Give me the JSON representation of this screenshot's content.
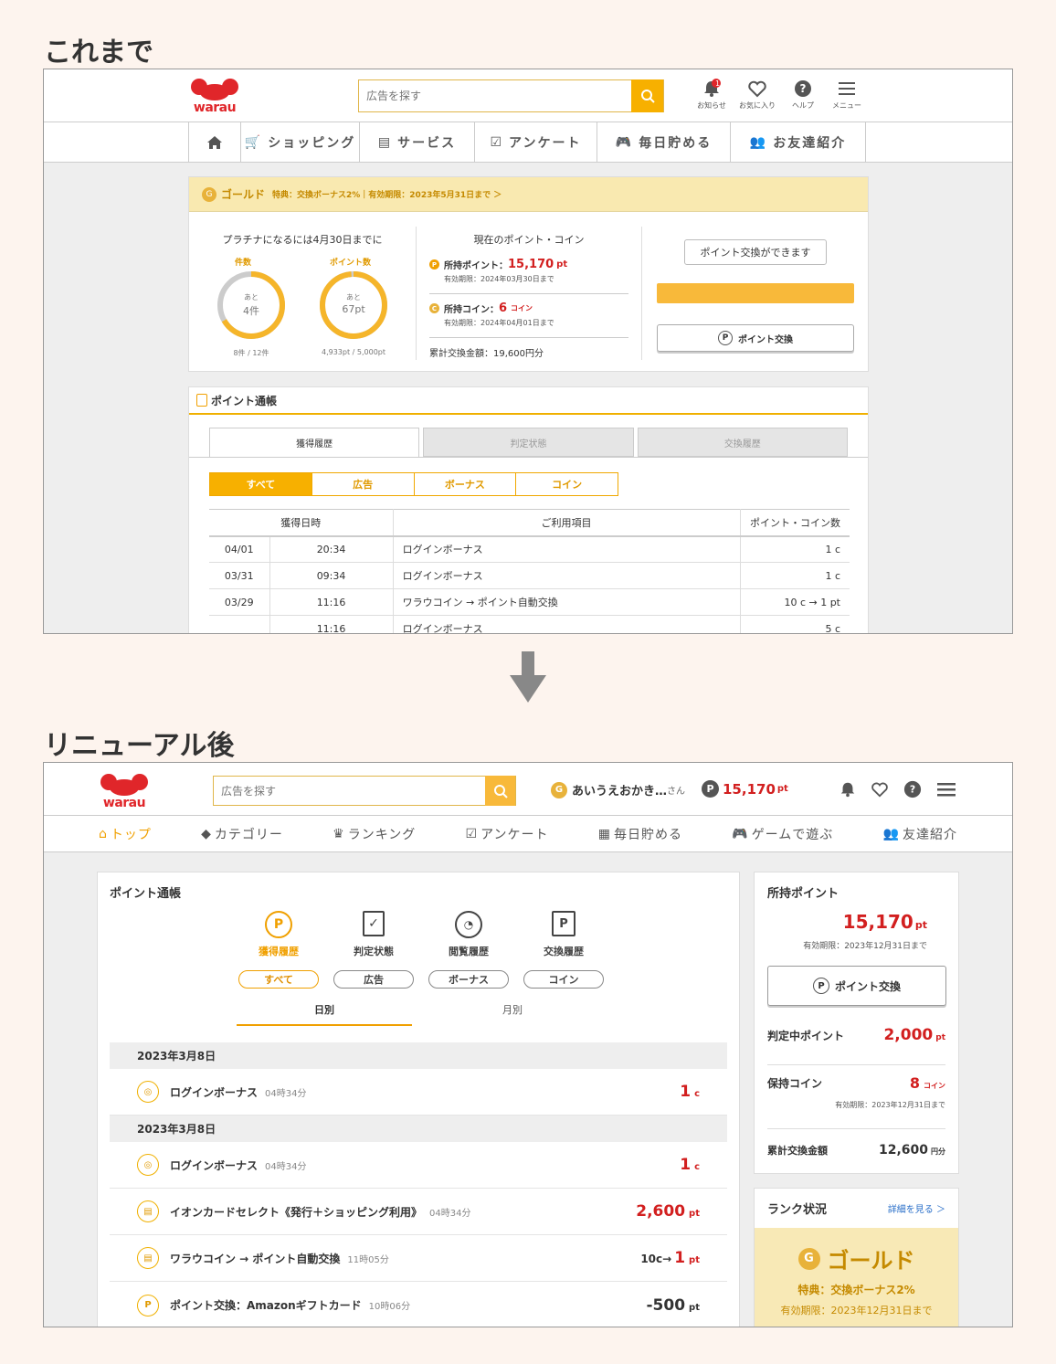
{
  "labels": {
    "before": "これまで",
    "after": "リニューアル後"
  },
  "old": {
    "logo": "warau",
    "search_placeholder": "広告を探す",
    "header_icons": [
      {
        "label": "お知らせ",
        "icon": "bell-icon",
        "badge": "1"
      },
      {
        "label": "お気に入り",
        "icon": "heart-icon"
      },
      {
        "label": "ヘルプ",
        "icon": "help-icon"
      },
      {
        "label": "メニュー",
        "icon": "menu-icon"
      }
    ],
    "nav": [
      "ショッピング",
      "サービス",
      "アンケート",
      "毎日貯める",
      "お友達紹介"
    ],
    "rank_bar": {
      "name": "ゴールド",
      "detail": "特典：交換ボーナス2%｜有効期限：2023年5月31日まで ＞"
    },
    "platinum": {
      "title": "プラチナになるには4月30日までに",
      "count_label": "件数",
      "count_inner_top": "あと",
      "count_inner": "4件",
      "count_sub": "8件 / 12件",
      "count_progress": 0.667,
      "point_label": "ポイント数",
      "point_inner_top": "あと",
      "point_inner": "67pt",
      "point_sub": "4,933pt / 5,000pt",
      "point_progress": 0.987
    },
    "current": {
      "title": "現在のポイント・コイン",
      "points_label": "所持ポイント：",
      "points_value": "15,170",
      "points_unit": "pt",
      "points_expiry": "有効期限：2024年03月30日まで",
      "coins_label": "所持コイン：",
      "coins_value": "6",
      "coins_unit": "コイン",
      "coins_expiry": "有効期限：2024年04月01日まで",
      "total": "累計交換金額：19,600円分"
    },
    "exchange": {
      "bubble": "ポイント交換ができます",
      "button": "ポイント交換"
    },
    "passbook_title": "ポイント通帳",
    "tabs": [
      "獲得履歴",
      "判定状態",
      "交換履歴"
    ],
    "filters": [
      "すべて",
      "広告",
      "ボーナス",
      "コイン"
    ],
    "table_headers": [
      "獲得日時",
      "ご利用項目",
      "ポイント・コイン数"
    ],
    "rows": [
      {
        "date": "04/01",
        "time": "20:34",
        "item": "ログインボーナス",
        "amount": "1 c"
      },
      {
        "date": "03/31",
        "time": "09:34",
        "item": "ログインボーナス",
        "amount": "1 c"
      },
      {
        "date": "03/29",
        "time": "11:16",
        "item": "ワラウコイン → ポイント自動交換",
        "amount": "10 c → 1 pt"
      },
      {
        "date": "",
        "time": "11:16",
        "item": "ログインボーナス",
        "amount": "5 c"
      }
    ]
  },
  "new": {
    "logo": "warau",
    "search_placeholder": "広告を探す",
    "user_name": "あいうえおかき…",
    "user_suffix": "さん",
    "header_points": "15,170",
    "header_points_unit": "pt",
    "nav": [
      "トップ",
      "カテゴリー",
      "ランキング",
      "アンケート",
      "毎日貯める",
      "ゲームで遊ぶ",
      "友達紹介"
    ],
    "passbook": {
      "title": "ポイント通帳",
      "icon_tabs": [
        "獲得履歴",
        "判定状態",
        "閲覧履歴",
        "交換履歴"
      ],
      "filters": [
        "すべて",
        "広告",
        "ボーナス",
        "コイン"
      ],
      "period_tabs": [
        "日別",
        "月別"
      ],
      "groups": [
        {
          "date": "2023年3月8日",
          "rows": [
            {
              "item": "ログインボーナス",
              "time": "04時34分",
              "amount": "1",
              "unit": "c",
              "icon": "coin-icon",
              "color": "red"
            }
          ]
        },
        {
          "date": "2023年3月8日",
          "rows": [
            {
              "item": "ログインボーナス",
              "time": "04時34分",
              "amount": "1",
              "unit": "c",
              "icon": "coin-icon",
              "color": "red"
            },
            {
              "item": "イオンカードセレクト《発行＋ショッピング利用》",
              "time": "04時34分",
              "amount": "2,600",
              "unit": "pt",
              "icon": "points-icon",
              "color": "red"
            },
            {
              "item": "ワラウコイン → ポイント自動交換",
              "time": "11時05分",
              "amount": "10c→",
              "amount2": "1",
              "unit": "pt",
              "icon": "points-icon",
              "color": "mixed"
            },
            {
              "item": "ポイント交換：Amazonギフトカード",
              "time": "10時06分",
              "amount": "-500",
              "unit": "pt",
              "icon": "exchange-icon",
              "color": "black"
            }
          ]
        }
      ]
    },
    "side": {
      "points_title": "所持ポイント",
      "points_value": "15,170",
      "points_unit": "pt",
      "points_expiry": "有効期限：2023年12月31日まで",
      "exchange_button": "ポイント交換",
      "pending_label": "判定中ポイント",
      "pending_value": "2,000",
      "pending_unit": "pt",
      "coins_label": "保持コイン",
      "coins_value": "8",
      "coins_unit": "コイン",
      "coins_expiry": "有効期限：2023年12月31日まで",
      "total_label": "累計交換金額",
      "total_value": "12,600",
      "total_unit": "円分",
      "rank_title": "ランク状況",
      "rank_link": "詳細を見る ＞",
      "rank_name": "ゴールド",
      "rank_benefit": "特典：交換ボーナス2%",
      "rank_expiry": "有効期限：2023年12月31日まで"
    }
  }
}
